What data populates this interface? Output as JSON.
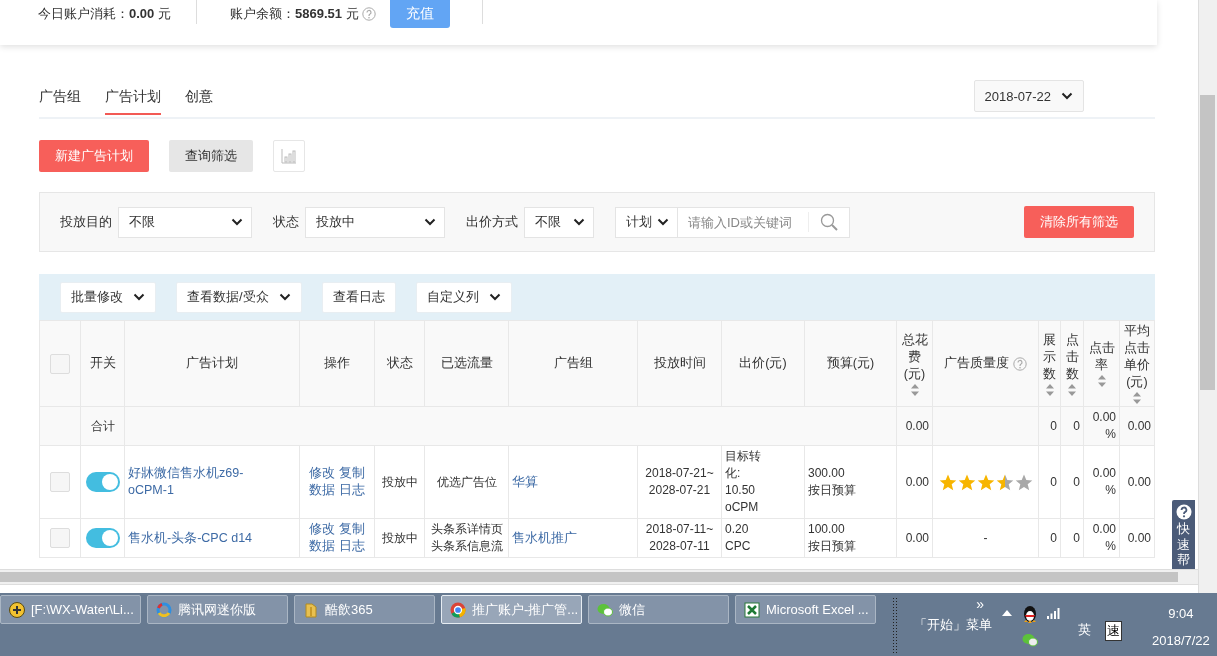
{
  "account": {
    "spend": "今日账户消耗：**0.00** 元",
    "balance": "账户余额：**5869.51** 元",
    "recharge_button": "充值"
  },
  "tabs": [
    {
      "label": "广告组",
      "selected": false
    },
    {
      "label": "广告计划",
      "selected": true
    },
    {
      "label": "创意",
      "selected": false
    }
  ],
  "date_picker": "2018-07-22",
  "actions": {
    "new_button": "新建广告计划",
    "query_button": "查询筛选"
  },
  "filters": [
    {
      "label": "投放目的",
      "value": "不限"
    },
    {
      "label": "状态",
      "value": "投放中"
    },
    {
      "label": "出价方式",
      "value": "不限"
    }
  ],
  "search": {
    "scope": "计划",
    "placeholder": "请输入ID或关键词"
  },
  "clear_button": "清除所有筛选",
  "toolbar": [
    {
      "label": "批量修改",
      "dropdown": true
    },
    {
      "label": "查看数据/受众",
      "dropdown": true
    },
    {
      "label": "查看日志",
      "dropdown": false
    },
    {
      "label": "自定义列",
      "dropdown": true
    }
  ],
  "table": {
    "header_checked": false,
    "columns": [
      {
        "label": "开关",
        "sortable": false,
        "help": false
      },
      {
        "label": "广告计划",
        "sortable": false,
        "help": false
      },
      {
        "label": "操作",
        "sortable": false,
        "help": false
      },
      {
        "label": "状态",
        "sortable": false,
        "help": false
      },
      {
        "label": "已选流量",
        "sortable": false,
        "help": false
      },
      {
        "label": "广告组",
        "sortable": false,
        "help": false
      },
      {
        "label": "投放时间",
        "sortable": false,
        "help": false
      },
      {
        "label": "出价(元)",
        "sortable": false,
        "help": false
      },
      {
        "label": "预算(元)",
        "sortable": false,
        "help": false
      },
      {
        "label": "总花费(元)",
        "sortable": true,
        "help": false
      },
      {
        "label": "广告质量度",
        "sortable": false,
        "help": true
      },
      {
        "label": "展示数",
        "sortable": true,
        "help": false
      },
      {
        "label": "点击数",
        "sortable": true,
        "help": false
      },
      {
        "label": "点击率",
        "sortable": true,
        "help": false
      },
      {
        "label": "平均点击单价(元)",
        "sortable": true,
        "help": false
      }
    ],
    "total_row": {
      "label": "合计",
      "cost": "0.00",
      "impressions": "0",
      "clicks": "0",
      "ctr": "0.00 %",
      "avg_cpc": "0.00"
    },
    "rows": [
      {
        "checked": false,
        "on": true,
        "name": "好牀微信售水机z69-oCPM-1",
        "ops": [
          "修改",
          "复制",
          "数据",
          "日志"
        ],
        "status": "投放中",
        "traffic": [
          "优选广告位"
        ],
        "group": "华算",
        "time": [
          "2018-07-21~",
          "2028-07-21"
        ],
        "bid": [
          "目标转化:",
          "10.50",
          "oCPM"
        ],
        "budget": [
          "300.00",
          "按日预算"
        ],
        "cost": "0.00",
        "quality": {
          "kind": "stars",
          "stars": 3.5
        },
        "impressions": "0",
        "clicks": "0",
        "ctr": "0.00 %",
        "avg_cpc": "0.00"
      },
      {
        "checked": false,
        "on": true,
        "name": "售水机-头条-CPC d14",
        "ops": [
          "修改",
          "复制",
          "数据",
          "日志"
        ],
        "status": "投放中",
        "traffic": [
          "头条系详情页",
          "头条系信息流"
        ],
        "group": "售水机推广",
        "time": [
          "2018-07-11~",
          "2028-07-11"
        ],
        "bid": [
          "0.20",
          "CPC"
        ],
        "budget": [
          "100.00",
          "按日预算"
        ],
        "cost": "0.00",
        "quality": {
          "kind": "text",
          "text": "-"
        },
        "impressions": "0",
        "clicks": "0",
        "ctr": "0.00 %",
        "avg_cpc": "0.00"
      }
    ]
  },
  "help_tab": "快速帮",
  "taskbar": {
    "tasks": [
      {
        "label": "[F:\\WX-Water\\Li...",
        "kind": "disc",
        "selected": false
      },
      {
        "label": "腾讯网迷你版",
        "kind": "ring",
        "selected": false
      },
      {
        "label": "酷飲365",
        "kind": "folder",
        "selected": false
      },
      {
        "label": "推广账户-推广管...",
        "kind": "browser",
        "selected": true
      },
      {
        "label": "微信",
        "kind": "chat",
        "selected": false
      },
      {
        "label": "Microsoft Excel ...",
        "kind": "sheet",
        "selected": false
      }
    ],
    "more": "»",
    "start_menu": "「开始」菜单",
    "ime": [
      "英",
      "速"
    ],
    "time": "9:04",
    "date": "2018/7/22"
  }
}
